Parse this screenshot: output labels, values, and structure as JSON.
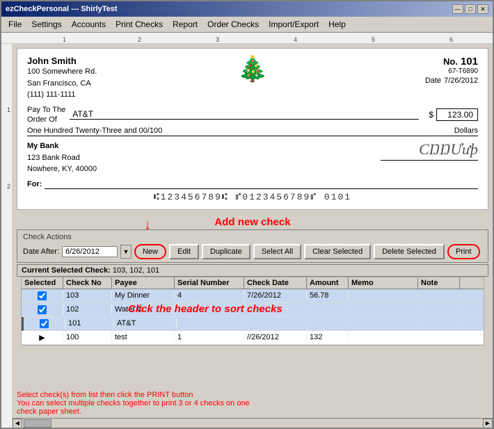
{
  "window": {
    "title": "ezCheckPersonal --- ShirlyTest"
  },
  "titlebar": {
    "minimize": "—",
    "maximize": "□",
    "close": "✕"
  },
  "menu": {
    "items": [
      "File",
      "Settings",
      "Accounts",
      "Print Checks",
      "Report",
      "Order Checks",
      "Import/Export",
      "Help"
    ]
  },
  "ruler": {
    "marks": [
      "1",
      "2",
      "3",
      "4",
      "5",
      "6"
    ]
  },
  "check": {
    "name": "John Smith",
    "address1": "100 Somewhere Rd.",
    "address2": "San Francisco, CA",
    "phone": "(111) 111-1111",
    "no_label": "No.",
    "no_value": "101",
    "routing_label": "67-T6890",
    "date_label": "Date",
    "date_value": "7/26/2012",
    "pay_to_label": "Pay To The",
    "order_of_label": "Order Of",
    "payee": "AT&T",
    "dollar_sign": "$",
    "amount": "123.00",
    "written_amount": "One Hundred Twenty-Three and 00/100",
    "dollars_label": "Dollars",
    "bank_name": "My Bank",
    "bank_address1": "123 Bank Road",
    "bank_address2": "Nowhere, KY, 40000",
    "for_label": "For:",
    "micr": "⑆123456789⑆  ⑈0123456789⑈  0101",
    "tree_emoji": "🎄"
  },
  "annotation": {
    "add_check": "Add new check",
    "click_header": "Click the header to sort checks"
  },
  "actions": {
    "section_label": "Check Actions",
    "date_label": "Date After:",
    "date_value": "6/26/2012",
    "buttons": {
      "new": "New",
      "edit": "Edit",
      "duplicate": "Duplicate",
      "select_all": "Select All",
      "clear_selected": "Clear Selected",
      "delete_selected": "Delete Selected",
      "print": "Print"
    }
  },
  "current_selected": {
    "label": "Current Selected Check:",
    "value": "103, 102, 101"
  },
  "table": {
    "headers": [
      "Selected",
      "Check No",
      "Payee",
      "Serial Number",
      "Check Date",
      "Amount",
      "Memo",
      "Note"
    ],
    "rows": [
      {
        "selected": true,
        "check_no": "103",
        "payee": "My Dinner",
        "serial": "4",
        "date": "7/26/2012",
        "amount": "56.78",
        "memo": "",
        "note": ""
      },
      {
        "selected": true,
        "check_no": "102",
        "payee": "Water C",
        "serial": "",
        "date": "",
        "amount": "",
        "memo": "",
        "note": ""
      },
      {
        "selected": true,
        "check_no": "101",
        "payee": "AT&T",
        "serial": "",
        "date": "",
        "amount": "",
        "memo": "",
        "note": ""
      },
      {
        "selected": false,
        "check_no": "100",
        "payee": "test",
        "serial": "1",
        "date": "//26/2012",
        "amount": "132",
        "memo": "",
        "note": ""
      }
    ]
  },
  "bottom_note": {
    "line1": "Select check(s) from list then click the PRINT button",
    "line2": "You can select multiple checks together to print 3 or 4 checks on one",
    "line3": "check paper sheet."
  }
}
